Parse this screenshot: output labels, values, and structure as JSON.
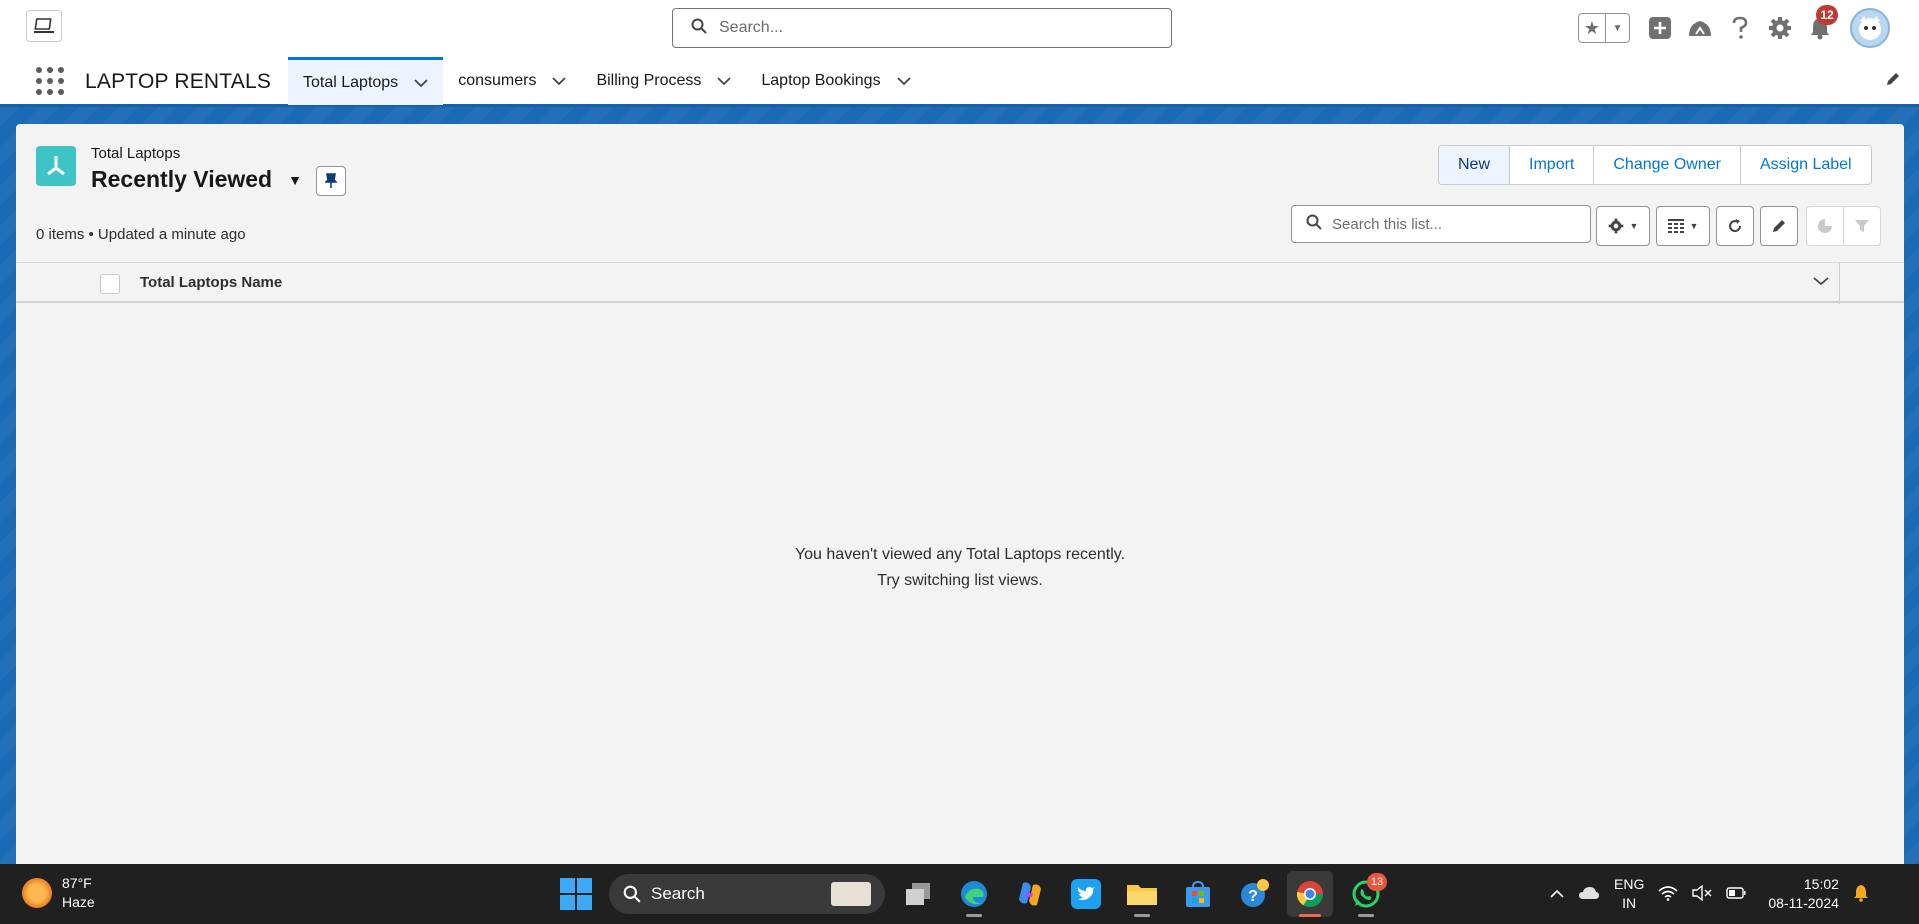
{
  "header": {
    "search_placeholder": "Search...",
    "notification_count": "12"
  },
  "nav": {
    "app_name": "LAPTOP RENTALS",
    "tabs": [
      {
        "label": "Total Laptops",
        "active": true
      },
      {
        "label": "consumers"
      },
      {
        "label": "Billing Process"
      },
      {
        "label": "Laptop Bookings"
      }
    ]
  },
  "list_view": {
    "object_label": "Total Laptops",
    "view_name": "Recently Viewed",
    "meta": "0 items • Updated a minute ago",
    "actions": [
      "New",
      "Import",
      "Change Owner",
      "Assign Label"
    ],
    "search_placeholder": "Search this list...",
    "columns": [
      "Total Laptops Name"
    ],
    "empty_line1": "You haven't viewed any Total Laptops recently.",
    "empty_line2": "Try switching list views."
  },
  "taskbar": {
    "weather_temp": "87°F",
    "weather_desc": "Haze",
    "search_label": "Search",
    "whatsapp_badge": "13",
    "lang_top": "ENG",
    "lang_bottom": "IN",
    "time": "15:02",
    "date": "08-11-2024"
  },
  "colors": {
    "brand_blue": "#0176d3",
    "nav_band": "#1b6ab5",
    "object_icon": "#3ec4c4",
    "badge_red": "#c23934"
  }
}
